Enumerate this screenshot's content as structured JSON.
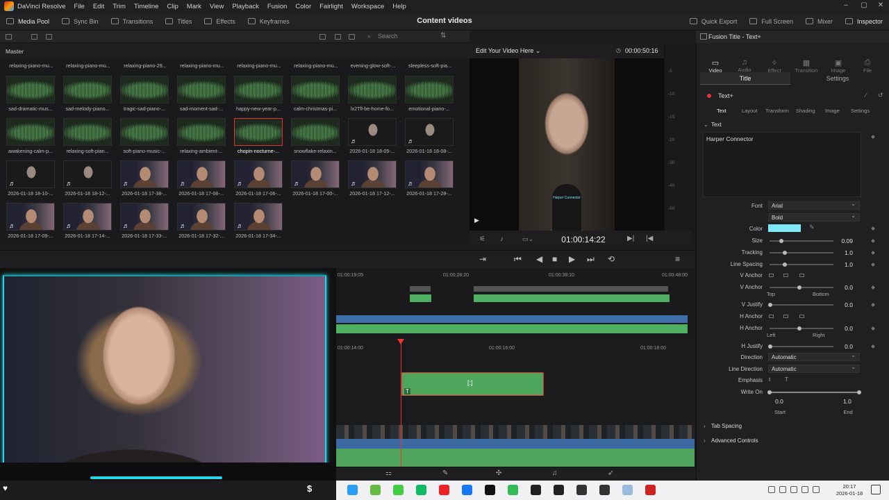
{
  "app": {
    "name": "DaVinci Resolve",
    "project_title": "Content videos"
  },
  "menu": [
    "File",
    "Edit",
    "Trim",
    "Timeline",
    "Clip",
    "Mark",
    "View",
    "Playback",
    "Fusion",
    "Color",
    "Fairlight",
    "Workspace",
    "Help"
  ],
  "toolbar": {
    "left": [
      "Media Pool",
      "Sync Bin",
      "Transitions",
      "Titles",
      "Effects",
      "Keyframes"
    ],
    "right": [
      "Quick Export",
      "Full Screen",
      "Mixer",
      "Inspector"
    ]
  },
  "media_pool": {
    "search_placeholder": "Search",
    "bin": "Master",
    "top_labels": [
      "relaxing-piano-mu...",
      "relaxing-piano-mu...",
      "relaxing-piano-29...",
      "relaxing-piano-mu...",
      "relaxing-piano-mu...",
      "relaxing-piano-mu...",
      "evening-glow-soft-...",
      "sleepless-soft-pia..."
    ],
    "clips": [
      {
        "label": "sad-dramatic-mus...",
        "kind": "audio"
      },
      {
        "label": "sad-melody-piano...",
        "kind": "audio"
      },
      {
        "label": "tragic-sad-piano-...",
        "kind": "audio"
      },
      {
        "label": "sad-moment-sad-...",
        "kind": "audio"
      },
      {
        "label": "happy-new-year-p...",
        "kind": "audio"
      },
      {
        "label": "calm-christmas-pi...",
        "kind": "audio"
      },
      {
        "label": "lx2Tll-be-home-fo...",
        "kind": "audio"
      },
      {
        "label": "emotional-piano-...",
        "kind": "audio"
      },
      {
        "label": "awakening-calm-p...",
        "kind": "audio"
      },
      {
        "label": "relaxing-soft-pian...",
        "kind": "audio"
      },
      {
        "label": "soft-piano-music-...",
        "kind": "audio"
      },
      {
        "label": "relaxing-ambient-...",
        "kind": "audio"
      },
      {
        "label": "chopin-nocturne-...",
        "kind": "audio",
        "selected": true
      },
      {
        "label": "snowflake-relaxin...",
        "kind": "audio"
      },
      {
        "label": "2026-01-18 18-05-...",
        "kind": "video-dark"
      },
      {
        "label": "2026-01-18 18-08-...",
        "kind": "video-dark"
      },
      {
        "label": "2026-01-18 18-10-...",
        "kind": "video-dark"
      },
      {
        "label": "2026-01-18 18-12-...",
        "kind": "video-dark"
      },
      {
        "label": "2026-01-18 17-38-...",
        "kind": "video"
      },
      {
        "label": "2026-01-18 17-06-...",
        "kind": "video"
      },
      {
        "label": "2026-01-18 17-06-...",
        "kind": "video"
      },
      {
        "label": "2026-01-18 17-00-...",
        "kind": "video"
      },
      {
        "label": "2026-01-18 17-12-...",
        "kind": "video"
      },
      {
        "label": "2026-01-18 17-28-...",
        "kind": "video"
      },
      {
        "label": "2026-01-18 17-09-...",
        "kind": "video"
      },
      {
        "label": "2026-01-18 17-14-...",
        "kind": "video"
      },
      {
        "label": "2026-01-18 17-33-...",
        "kind": "video"
      },
      {
        "label": "2026-01-18 17-32-...",
        "kind": "video"
      },
      {
        "label": "2026-01-18 17-34-...",
        "kind": "video"
      }
    ]
  },
  "viewer": {
    "title": "Edit Your Video Here",
    "duration": "00:00:50:16",
    "timecode": "01:00:14:22",
    "caption": "Harper Connector"
  },
  "meter_scale": [
    "-5",
    "-10",
    "-15",
    "-20",
    "-30",
    "-40",
    "-50"
  ],
  "timeline": {
    "upper_ruler": [
      "01:00:19:05",
      "01:00:28:20",
      "01:00:38:10",
      "01:00:48:00"
    ],
    "lower_ruler": [
      "01:00:14:00",
      "01:00:16:00",
      "01:00:18:00"
    ]
  },
  "inspector": {
    "header": "Fusion Title - Text+",
    "tabs": [
      "Video",
      "Audio",
      "Effect",
      "Transition",
      "Image",
      "File"
    ],
    "subtabs": [
      "Title",
      "Settings"
    ],
    "node": "Text+",
    "node_tabs": [
      "Text",
      "Layout",
      "Transform",
      "Shading",
      "Image",
      "Settings"
    ],
    "section": "Text",
    "text_value": "Harper Connector",
    "font": "Arial",
    "style": "Bold",
    "color_hex": "#7fe8f7",
    "labels": {
      "font": "Font",
      "color": "Color",
      "size": "Size",
      "tracking": "Tracking",
      "line_spacing": "Line Spacing",
      "v_anchor": "V Anchor",
      "v_anchor2": "V Anchor",
      "v_justify": "V Justify",
      "h_anchor": "H Anchor",
      "h_anchor2": "H Anchor",
      "h_justify": "H Justify",
      "direction": "Direction",
      "line_direction": "Line Direction",
      "emphasis": "Emphasis",
      "write_on": "Write On"
    },
    "values": {
      "size": "0.09",
      "tracking": "1.0",
      "line_spacing": "1.0",
      "v_anchor": "0.0",
      "v_justify": "0.0",
      "h_anchor": "0.0",
      "h_justify": "0.0",
      "direction": "Automatic",
      "line_direction": "Automatic",
      "write_on_start": "0.0",
      "write_on_end": "1.0"
    },
    "sub_labels": {
      "top": "Top",
      "bottom": "Bottom",
      "left": "Left",
      "right": "Right",
      "start": "Start",
      "end": "End"
    },
    "collapsed_sections": [
      "Tab Spacing",
      "Advanced Controls"
    ]
  },
  "taskbar": {
    "time": "20:17",
    "date": "2026-01-18"
  }
}
